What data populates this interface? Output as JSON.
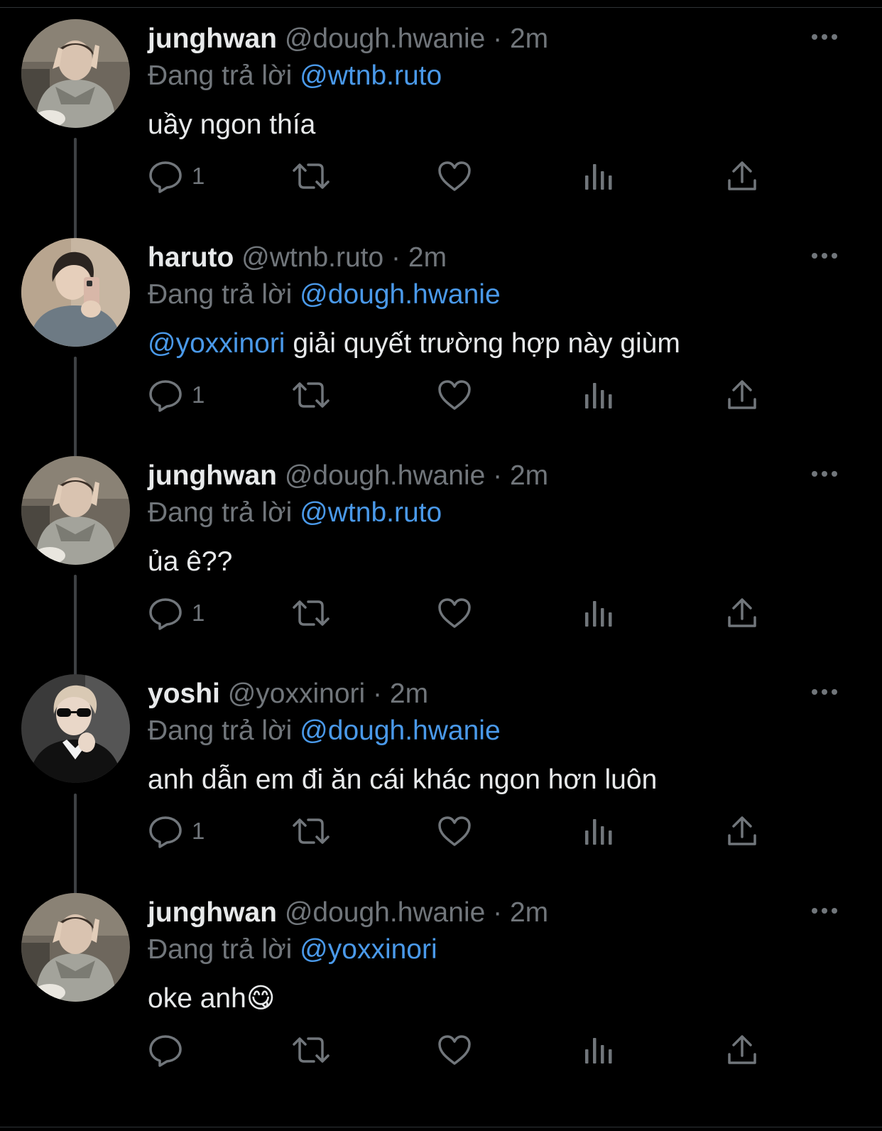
{
  "colors": {
    "background": "#000000",
    "text": "#e7e9ea",
    "muted": "#71767b",
    "accent": "#4a99e9",
    "thread_line": "#3e4144"
  },
  "reply_prefix": "Đang trả lời",
  "tweets": [
    {
      "display_name": "junghwan",
      "handle": "@dough.hwanie",
      "separator": "·",
      "time": "2m",
      "replying_to": "@wtnb.ruto",
      "mention": "",
      "text": "uầy ngon thía",
      "reply_count": "1",
      "avatar": "avatar-junghwan"
    },
    {
      "display_name": "haruto",
      "handle": "@wtnb.ruto",
      "separator": "·",
      "time": "2m",
      "replying_to": "@dough.hwanie",
      "mention": "@yoxxinori",
      "text": " giải quyết trường hợp này giùm",
      "reply_count": "1",
      "avatar": "avatar-haruto"
    },
    {
      "display_name": "junghwan",
      "handle": "@dough.hwanie",
      "separator": "·",
      "time": "2m",
      "replying_to": "@wtnb.ruto",
      "mention": "",
      "text": "ủa ê??",
      "reply_count": "1",
      "avatar": "avatar-junghwan"
    },
    {
      "display_name": "yoshi",
      "handle": "@yoxxinori",
      "separator": "·",
      "time": "2m",
      "replying_to": "@dough.hwanie",
      "mention": "",
      "text": "anh dẫn em đi ăn cái khác ngon hơn luôn",
      "reply_count": "1",
      "avatar": "avatar-yoshi"
    },
    {
      "display_name": "junghwan",
      "handle": "@dough.hwanie",
      "separator": "·",
      "time": "2m",
      "replying_to": "@yoxxinori",
      "mention": "",
      "text": "oke anh😋",
      "reply_count": "",
      "avatar": "avatar-junghwan"
    }
  ],
  "icons": {
    "reply": "reply-icon",
    "retweet": "retweet-icon",
    "like": "heart-icon",
    "views": "views-icon",
    "share": "share-icon",
    "more": "more-icon"
  }
}
